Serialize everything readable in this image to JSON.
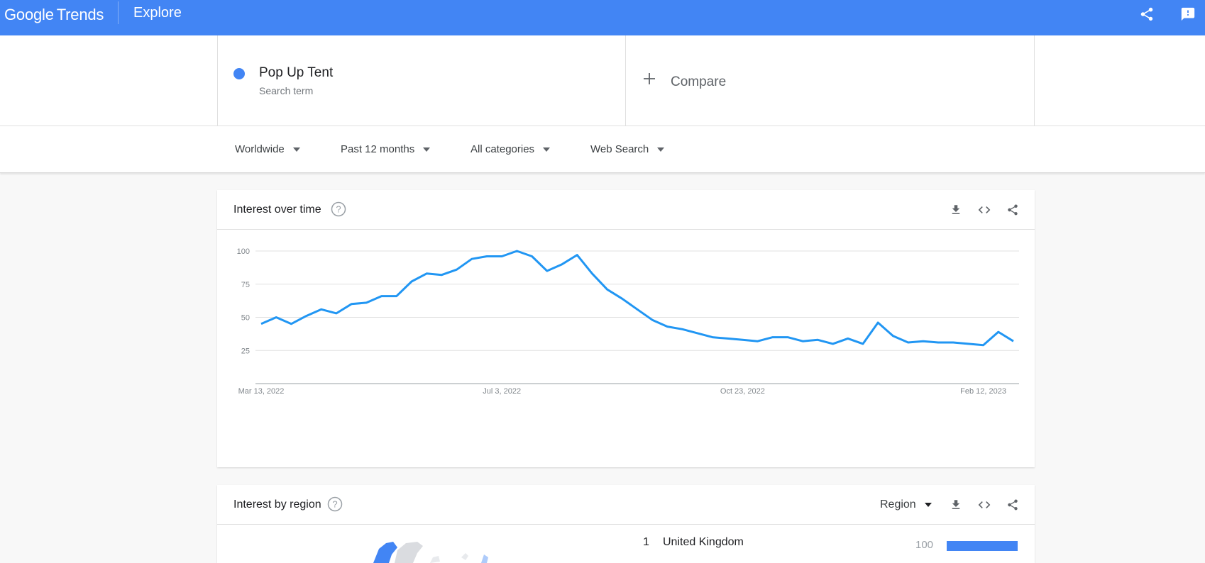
{
  "header": {
    "brand_google": "Google",
    "brand_trends": "Trends",
    "section": "Explore",
    "icons": [
      "share-icon",
      "feedback-icon"
    ]
  },
  "search": {
    "term": "Pop Up Tent",
    "term_type": "Search term",
    "term_color": "#4285f4",
    "compare_label": "Compare"
  },
  "filters": {
    "region": "Worldwide",
    "time": "Past 12 months",
    "category": "All categories",
    "property": "Web Search"
  },
  "interest_over_time": {
    "title": "Interest over time",
    "actions": [
      "download-icon",
      "embed-icon",
      "share-icon"
    ]
  },
  "chart_data": {
    "type": "line",
    "title": "",
    "xlabel": "",
    "ylabel": "",
    "ylim": [
      0,
      100
    ],
    "y_ticks": [
      25,
      50,
      75,
      100
    ],
    "x_tick_labels": [
      "Mar 13, 2022",
      "Jul 3, 2022",
      "Oct 23, 2022",
      "Feb 12, 2023"
    ],
    "x_tick_index": [
      0,
      16,
      32,
      48
    ],
    "grid": true,
    "legend": "none",
    "series": [
      {
        "color": "#2196f3",
        "values": [
          45,
          50,
          45,
          51,
          56,
          53,
          60,
          61,
          66,
          66,
          77,
          83,
          82,
          86,
          94,
          96,
          96,
          100,
          96,
          85,
          90,
          97,
          83,
          71,
          64,
          56,
          48,
          43,
          41,
          38,
          35,
          34,
          33,
          32,
          35,
          35,
          32,
          33,
          30,
          34,
          30,
          46,
          36,
          31,
          32,
          31,
          31,
          30,
          29,
          39,
          32
        ]
      }
    ]
  },
  "interest_by_region": {
    "title": "Interest by region",
    "resolution": "Region",
    "actions": [
      "download-icon",
      "embed-icon",
      "share-icon"
    ],
    "rows": [
      {
        "rank": "1",
        "name": "United Kingdom",
        "value": "100",
        "fraction": 1.0
      }
    ],
    "bar_color": "#4285f4"
  }
}
